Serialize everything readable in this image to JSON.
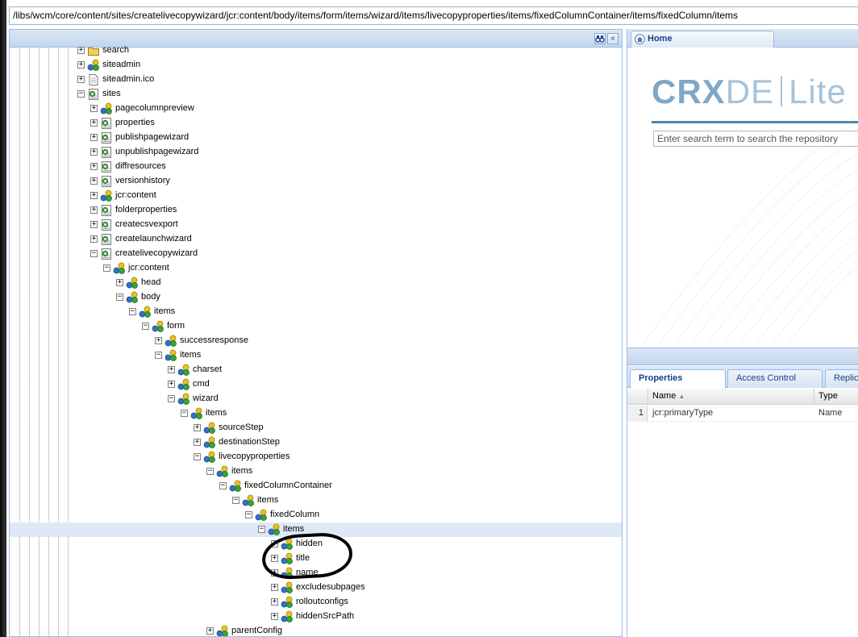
{
  "path_bar": {
    "value": "/libs/wcm/core/content/sites/createlivecopywizard/jcr:content/body/items/form/items/wizard/items/livecopyproperties/items/fixedColumnContainer/items/fixedColumn/items"
  },
  "tree_header": {
    "refresh_icon": "binoculars-icon",
    "collapse_icon": "double-chevron-left-icon"
  },
  "tree": {
    "nodes": [
      {
        "label": "search",
        "depth": 0,
        "expanded": false,
        "icon": "folder"
      },
      {
        "label": "siteadmin",
        "depth": 0,
        "expanded": false,
        "icon": "node"
      },
      {
        "label": "siteadmin.ico",
        "depth": 0,
        "expanded": false,
        "icon": "file"
      },
      {
        "label": "sites",
        "depth": 0,
        "expanded": true,
        "icon": "page"
      },
      {
        "label": "pagecolumnpreview",
        "depth": 1,
        "expanded": false,
        "icon": "node"
      },
      {
        "label": "properties",
        "depth": 1,
        "expanded": false,
        "icon": "page"
      },
      {
        "label": "publishpagewizard",
        "depth": 1,
        "expanded": false,
        "icon": "page"
      },
      {
        "label": "unpublishpagewizard",
        "depth": 1,
        "expanded": false,
        "icon": "page"
      },
      {
        "label": "diffresources",
        "depth": 1,
        "expanded": false,
        "icon": "page"
      },
      {
        "label": "versionhistory",
        "depth": 1,
        "expanded": false,
        "icon": "page"
      },
      {
        "label": "jcr:content",
        "depth": 1,
        "expanded": false,
        "icon": "node"
      },
      {
        "label": "folderproperties",
        "depth": 1,
        "expanded": false,
        "icon": "page"
      },
      {
        "label": "createcsvexport",
        "depth": 1,
        "expanded": false,
        "icon": "page"
      },
      {
        "label": "createlaunchwizard",
        "depth": 1,
        "expanded": false,
        "icon": "page"
      },
      {
        "label": "createlivecopywizard",
        "depth": 1,
        "expanded": true,
        "icon": "page"
      },
      {
        "label": "jcr:content",
        "depth": 2,
        "expanded": true,
        "icon": "node"
      },
      {
        "label": "head",
        "depth": 3,
        "expanded": false,
        "icon": "node"
      },
      {
        "label": "body",
        "depth": 3,
        "expanded": true,
        "icon": "node"
      },
      {
        "label": "items",
        "depth": 4,
        "expanded": true,
        "icon": "node"
      },
      {
        "label": "form",
        "depth": 5,
        "expanded": true,
        "icon": "node"
      },
      {
        "label": "successresponse",
        "depth": 6,
        "expanded": false,
        "icon": "node"
      },
      {
        "label": "items",
        "depth": 6,
        "expanded": true,
        "icon": "node"
      },
      {
        "label": "charset",
        "depth": 7,
        "expanded": false,
        "icon": "node"
      },
      {
        "label": "cmd",
        "depth": 7,
        "expanded": false,
        "icon": "node"
      },
      {
        "label": "wizard",
        "depth": 7,
        "expanded": true,
        "icon": "node"
      },
      {
        "label": "items",
        "depth": 8,
        "expanded": true,
        "icon": "node"
      },
      {
        "label": "sourceStep",
        "depth": 9,
        "expanded": false,
        "icon": "node"
      },
      {
        "label": "destinationStep",
        "depth": 9,
        "expanded": false,
        "icon": "node"
      },
      {
        "label": "livecopyproperties",
        "depth": 9,
        "expanded": true,
        "icon": "node"
      },
      {
        "label": "items",
        "depth": 10,
        "expanded": true,
        "icon": "node"
      },
      {
        "label": "fixedColumnContainer",
        "depth": 11,
        "expanded": true,
        "icon": "node"
      },
      {
        "label": "items",
        "depth": 12,
        "expanded": true,
        "icon": "node"
      },
      {
        "label": "fixedColumn",
        "depth": 13,
        "expanded": true,
        "icon": "node"
      },
      {
        "label": "items",
        "depth": 14,
        "expanded": true,
        "icon": "node",
        "selected": true
      },
      {
        "label": "hidden",
        "depth": 15,
        "expanded": false,
        "icon": "node"
      },
      {
        "label": "title",
        "depth": 15,
        "expanded": false,
        "icon": "node"
      },
      {
        "label": "name",
        "depth": 15,
        "expanded": false,
        "icon": "node"
      },
      {
        "label": "excludesubpages",
        "depth": 15,
        "expanded": false,
        "icon": "node"
      },
      {
        "label": "rolloutconfigs",
        "depth": 15,
        "expanded": false,
        "icon": "node"
      },
      {
        "label": "hiddenSrcPath",
        "depth": 15,
        "expanded": false,
        "icon": "node"
      },
      {
        "label": "parentConfig",
        "depth": 10,
        "expanded": false,
        "icon": "node"
      }
    ]
  },
  "home_tab": {
    "label": "Home",
    "icon": "home-icon"
  },
  "crx": {
    "logo_crx": "CRX",
    "logo_de": "DE",
    "logo_lite": "Lite",
    "search_placeholder": "Enter search term to search the repository"
  },
  "properties_panel": {
    "tabs": [
      "Properties",
      "Access Control",
      "Replication"
    ],
    "columns": [
      "Name",
      "Type"
    ],
    "rows": [
      {
        "num": "1",
        "name": "jcr:primaryType",
        "type": "Name"
      }
    ]
  },
  "colors": {
    "panel_border": "#99bbe8",
    "header_blue": "#c3d6ee",
    "selected_row": "#dfe8f6",
    "tab_text": "#15428b",
    "logo": "#7fa8c6"
  }
}
